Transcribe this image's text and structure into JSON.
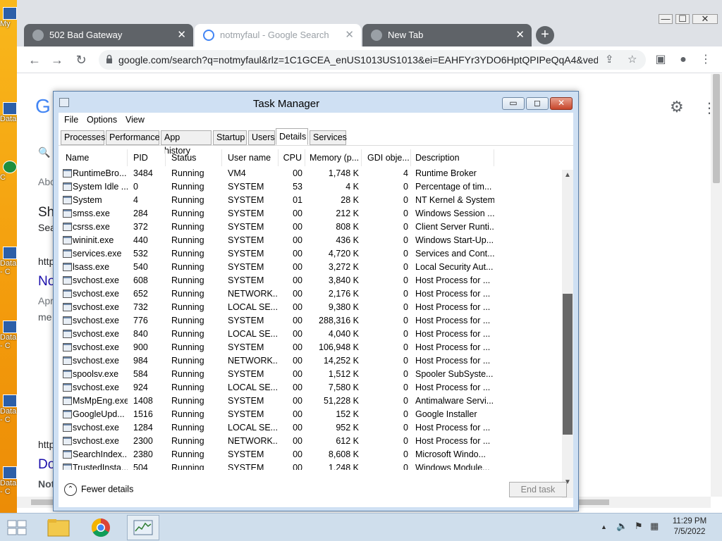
{
  "desktop": {
    "icons": [
      {
        "label": "My"
      },
      {
        "label": "Data"
      },
      {
        "label": "C"
      },
      {
        "label": "Data - C"
      },
      {
        "label": "Data - C"
      },
      {
        "label": "Data - C"
      },
      {
        "label": "Data - C"
      }
    ]
  },
  "browser": {
    "tabs": [
      {
        "title": "502 Bad Gateway"
      },
      {
        "title": "notmyfaul - Google Search"
      },
      {
        "title": "New Tab"
      }
    ],
    "close_glyph": "✕",
    "new_tab_glyph": "+",
    "window_controls": {
      "minimize": "—",
      "maximize": "☐",
      "close": "✕"
    },
    "nav": {
      "back": "←",
      "forward": "→",
      "reload": "↻"
    },
    "url": "google.com/search?q=notmyfaul&rlz=1C1GCEA_enUS1013US1013&ei=EAHFYr3YDO6HptQPIPeQqA4&ved...",
    "toolbar_icons": {
      "share": "⇪",
      "star": "☆",
      "sidepanel": "▣",
      "profile": "●",
      "menu": "⋮"
    }
  },
  "page": {
    "fragments": [
      {
        "text": "G"
      },
      {
        "text": "Abo"
      },
      {
        "text": "Sh"
      },
      {
        "text": "Sea"
      },
      {
        "text": "http"
      },
      {
        "text": "No"
      },
      {
        "text": "Apr"
      },
      {
        "text": "me"
      },
      {
        "text": "http"
      },
      {
        "text": "Do"
      },
      {
        "text": "Not"
      }
    ],
    "settings_glyph": "⚙",
    "menu_glyph": "⋮"
  },
  "task_manager": {
    "title": "Task Manager",
    "buttons": {
      "minimize": "▭",
      "maximize": "◻",
      "close": "✕"
    },
    "menu": [
      "File",
      "Options",
      "View"
    ],
    "tabs": [
      "Processes",
      "Performance",
      "App history",
      "Startup",
      "Users",
      "Details",
      "Services"
    ],
    "selected_tab": "Details",
    "columns": [
      "Name",
      "PID",
      "Status",
      "User name",
      "CPU",
      "Memory (p...",
      "GDI obje...",
      "Description"
    ],
    "rows": [
      [
        "RuntimeBro...",
        "3484",
        "Running",
        "VM4",
        "00",
        "1,748 K",
        "4",
        "Runtime Broker"
      ],
      [
        "System Idle ...",
        "0",
        "Running",
        "SYSTEM",
        "53",
        "4 K",
        "0",
        "Percentage of tim..."
      ],
      [
        "System",
        "4",
        "Running",
        "SYSTEM",
        "01",
        "28 K",
        "0",
        "NT Kernel & System"
      ],
      [
        "smss.exe",
        "284",
        "Running",
        "SYSTEM",
        "00",
        "212 K",
        "0",
        "Windows Session ..."
      ],
      [
        "csrss.exe",
        "372",
        "Running",
        "SYSTEM",
        "00",
        "808 K",
        "0",
        "Client Server Runti..."
      ],
      [
        "wininit.exe",
        "440",
        "Running",
        "SYSTEM",
        "00",
        "436 K",
        "0",
        "Windows Start-Up..."
      ],
      [
        "services.exe",
        "532",
        "Running",
        "SYSTEM",
        "00",
        "4,720 K",
        "0",
        "Services and Cont..."
      ],
      [
        "lsass.exe",
        "540",
        "Running",
        "SYSTEM",
        "00",
        "3,272 K",
        "0",
        "Local Security Aut..."
      ],
      [
        "svchost.exe",
        "608",
        "Running",
        "SYSTEM",
        "00",
        "3,840 K",
        "0",
        "Host Process for ..."
      ],
      [
        "svchost.exe",
        "652",
        "Running",
        "NETWORK...",
        "00",
        "2,176 K",
        "0",
        "Host Process for ..."
      ],
      [
        "svchost.exe",
        "732",
        "Running",
        "LOCAL SE...",
        "00",
        "9,380 K",
        "0",
        "Host Process for ..."
      ],
      [
        "svchost.exe",
        "776",
        "Running",
        "SYSTEM",
        "00",
        "288,316 K",
        "0",
        "Host Process for ..."
      ],
      [
        "svchost.exe",
        "840",
        "Running",
        "LOCAL SE...",
        "00",
        "4,040 K",
        "0",
        "Host Process for ..."
      ],
      [
        "svchost.exe",
        "900",
        "Running",
        "SYSTEM",
        "00",
        "106,948 K",
        "0",
        "Host Process for ..."
      ],
      [
        "svchost.exe",
        "984",
        "Running",
        "NETWORK...",
        "00",
        "14,252 K",
        "0",
        "Host Process for ..."
      ],
      [
        "spoolsv.exe",
        "584",
        "Running",
        "SYSTEM",
        "00",
        "1,512 K",
        "0",
        "Spooler SubSyste..."
      ],
      [
        "svchost.exe",
        "924",
        "Running",
        "LOCAL SE...",
        "00",
        "7,580 K",
        "0",
        "Host Process for ..."
      ],
      [
        "MsMpEng.exe",
        "1408",
        "Running",
        "SYSTEM",
        "00",
        "51,228 K",
        "0",
        "Antimalware Servi..."
      ],
      [
        "GoogleUpd...",
        "1516",
        "Running",
        "SYSTEM",
        "00",
        "152 K",
        "0",
        "Google Installer"
      ],
      [
        "svchost.exe",
        "1284",
        "Running",
        "LOCAL SE...",
        "00",
        "952 K",
        "0",
        "Host Process for ..."
      ],
      [
        "svchost.exe",
        "2300",
        "Running",
        "NETWORK...",
        "00",
        "612 K",
        "0",
        "Host Process for ..."
      ],
      [
        "SearchIndex...",
        "2380",
        "Running",
        "SYSTEM",
        "00",
        "8,608 K",
        "0",
        "Microsoft Windo..."
      ],
      [
        "TrustedInsta...",
        "504",
        "Running",
        "SYSTEM",
        "00",
        "1,248 K",
        "0",
        "Windows Module..."
      ]
    ],
    "scroll_up": "▲",
    "scroll_down": "▼",
    "fewer_details": "Fewer details",
    "fewer_glyph": "⌃",
    "end_task": "End task"
  },
  "taskbar": {
    "tray_icons": {
      "chevron": "▲",
      "volume": "🔈",
      "flag": "⚑",
      "network": "▦"
    },
    "time": "11:29 PM",
    "date": "7/5/2022"
  },
  "colors": {
    "desktop": "#f39b0c",
    "task_manager_frame": "#cfe0f3",
    "link": "#1a0dab",
    "taskbar": "#cfdeec"
  }
}
